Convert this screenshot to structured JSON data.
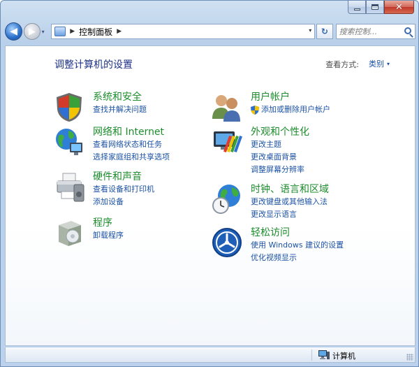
{
  "window": {
    "caption_minimize": "—",
    "caption_maximize": "□",
    "caption_close": "✕"
  },
  "nav": {
    "back_glyph": "◀",
    "forward_glyph": "▶",
    "history_glyph": "▾",
    "refresh_glyph": "↻"
  },
  "address": {
    "sep_glyph": "▶",
    "path": "控制面板",
    "drop_glyph": "▾"
  },
  "search": {
    "placeholder": "搜索控制..."
  },
  "header": {
    "title": "调整计算机的设置",
    "view_by_label": "查看方式:",
    "view_mode": "类别",
    "view_mode_arrow": "▾"
  },
  "categories": {
    "system": {
      "title": "系统和安全",
      "links": [
        "查找并解决问题"
      ]
    },
    "network": {
      "title": "网络和 Internet",
      "links": [
        "查看网络状态和任务",
        "选择家庭组和共享选项"
      ]
    },
    "hardware": {
      "title": "硬件和声音",
      "links": [
        "查看设备和打印机",
        "添加设备"
      ]
    },
    "programs": {
      "title": "程序",
      "links": [
        "卸载程序"
      ]
    },
    "users": {
      "title": "用户帐户",
      "links": [
        "添加或删除用户帐户"
      ]
    },
    "appearance": {
      "title": "外观和个性化",
      "links": [
        "更改主题",
        "更改桌面背景",
        "调整屏幕分辨率"
      ]
    },
    "clock": {
      "title": "时钟、语言和区域",
      "links": [
        "更改键盘或其他输入法",
        "更改显示语言"
      ]
    },
    "access": {
      "title": "轻松访问",
      "links": [
        "使用 Windows 建议的设置",
        "优化视频显示"
      ]
    }
  },
  "icons": {
    "system": "shield-icon",
    "network": "globe-network-icon",
    "hardware": "printer-icon",
    "programs": "program-box-icon",
    "users": "users-icon",
    "appearance": "monitor-paint-icon",
    "clock": "clock-globe-icon",
    "access": "ease-of-access-icon"
  },
  "statusbar": {
    "text": "计算机"
  },
  "colors": {
    "category_title": "#1c8c2c",
    "link": "#1c52a5",
    "heading": "#1e3287"
  }
}
